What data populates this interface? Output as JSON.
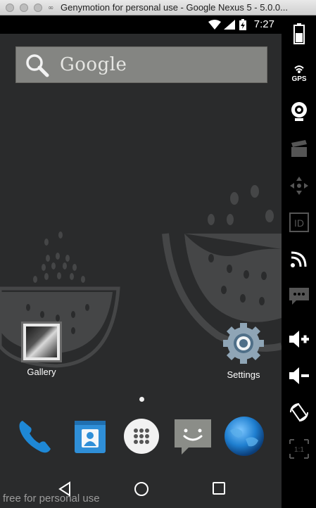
{
  "window": {
    "title": "Genymotion for personal use - Google Nexus 5 - 5.0.0..."
  },
  "status_bar": {
    "time": "7:27"
  },
  "search": {
    "label": "Google"
  },
  "home": {
    "apps": [
      {
        "label": "Gallery",
        "icon": "gallery-icon"
      },
      {
        "label": "Settings",
        "icon": "settings-gear-icon"
      }
    ],
    "dock": [
      {
        "icon": "phone-icon"
      },
      {
        "icon": "contacts-icon"
      },
      {
        "icon": "app-drawer-icon"
      },
      {
        "icon": "messaging-icon"
      },
      {
        "icon": "browser-icon"
      }
    ]
  },
  "nav": {
    "buttons": [
      "back-icon",
      "home-icon",
      "recents-icon"
    ]
  },
  "watermark": "free for personal use",
  "toolbar": {
    "items": [
      {
        "icon": "battery-icon"
      },
      {
        "icon": "gps-icon",
        "label": "GPS"
      },
      {
        "icon": "webcam-icon"
      },
      {
        "icon": "screencast-icon"
      },
      {
        "icon": "dpad-icon"
      },
      {
        "icon": "id-icon",
        "label": "ID"
      },
      {
        "icon": "network-icon"
      },
      {
        "icon": "sms-icon"
      },
      {
        "icon": "volume-up-icon"
      },
      {
        "icon": "volume-down-icon"
      },
      {
        "icon": "rotate-icon"
      },
      {
        "icon": "scale-icon",
        "label": "1:1"
      }
    ]
  },
  "colors": {
    "screen_bg": "#2a2b2c",
    "search_bg": "#848582",
    "phone_blue": "#1e88d6",
    "contacts_blue": "#2f8fd8",
    "messaging_gray": "#8b8d88"
  }
}
